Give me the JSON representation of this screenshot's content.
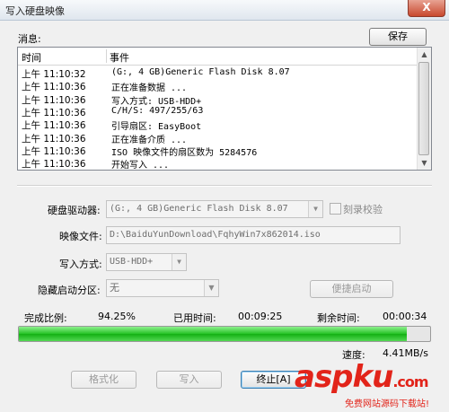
{
  "window": {
    "title": "写入硬盘映像",
    "close_glyph": "X"
  },
  "messages": {
    "label": "消息:",
    "save_button": "保存",
    "columns": {
      "time": "时间",
      "event": "事件"
    },
    "rows": [
      {
        "time": "上午 11:10:32",
        "event": "(G:, 4 GB)Generic Flash Disk      8.07"
      },
      {
        "time": "上午 11:10:36",
        "event": "正在准备数据 ..."
      },
      {
        "time": "上午 11:10:36",
        "event": "写入方式: USB-HDD+"
      },
      {
        "time": "上午 11:10:36",
        "event": "C/H/S: 497/255/63"
      },
      {
        "time": "上午 11:10:36",
        "event": "引导扇区: EasyBoot"
      },
      {
        "time": "上午 11:10:36",
        "event": "正在准备介质 ..."
      },
      {
        "time": "上午 11:10:36",
        "event": "ISO 映像文件的扇区数为 5284576"
      },
      {
        "time": "上午 11:10:36",
        "event": "开始写入 ..."
      }
    ]
  },
  "form": {
    "drive_label": "硬盘驱动器:",
    "drive_value": "(G:, 4 GB)Generic Flash Disk     8.07",
    "verify_label": "刻录校验",
    "image_label": "映像文件:",
    "image_value": "D:\\BaiduYunDownload\\FqhyWin7x862014.iso",
    "method_label": "写入方式:",
    "method_value": "USB-HDD+",
    "hidden_label": "隐藏启动分区:",
    "hidden_value": "无",
    "quick_boot_button": "便捷启动"
  },
  "status": {
    "done_label": "完成比例:",
    "done_value": "94.25%",
    "progress_fraction": 0.9425,
    "elapsed_label": "已用时间:",
    "elapsed_value": "00:09:25",
    "remaining_label": "剩余时间:",
    "remaining_value": "00:00:34",
    "speed_label": "速度:",
    "speed_value": "4.41MB/s"
  },
  "buttons": {
    "format": "格式化",
    "write": "写入",
    "stop": "终止[A]"
  },
  "watermark": {
    "main": "aspku",
    "tld": ".com",
    "sub": "免费网站源码下载站!"
  }
}
